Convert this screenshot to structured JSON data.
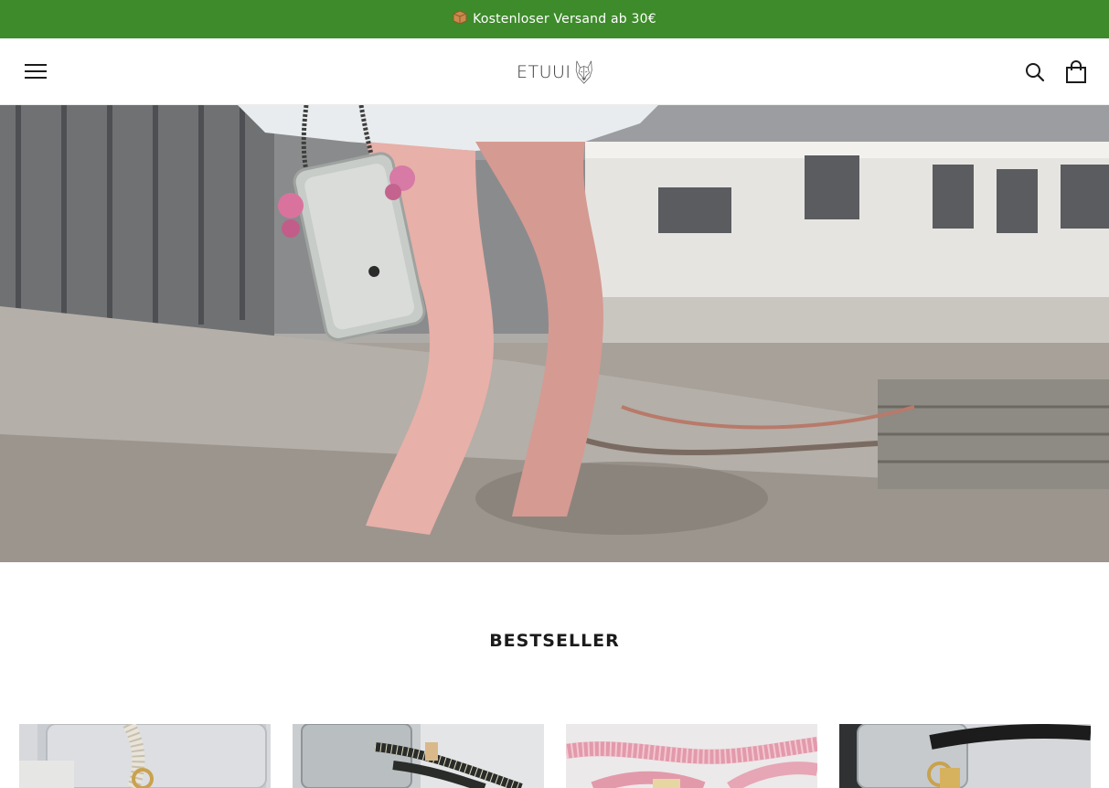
{
  "announcement": {
    "icon": "package-icon",
    "text": "Kostenloser Versand ab 30€",
    "background": "#3d8b2a"
  },
  "header": {
    "logo_text": "ETUUI",
    "logo_icon": "wolf-head-icon",
    "menu_icon": "hamburger-menu-icon",
    "search_icon": "search-icon",
    "cart_icon": "shopping-bag-icon"
  },
  "bestseller": {
    "title": "BESTSELLER",
    "products": [
      {
        "image": "product-image-white-cord-clear-case"
      },
      {
        "image": "product-image-black-dotted-cord-clear-case"
      },
      {
        "image": "product-image-pink-cord"
      },
      {
        "image": "product-image-black-cord-clear-case"
      }
    ]
  }
}
